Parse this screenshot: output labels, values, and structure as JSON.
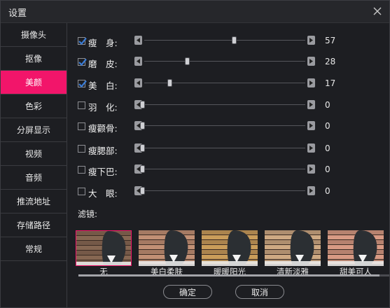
{
  "window": {
    "title": "设置"
  },
  "sidebar": {
    "items": [
      {
        "label": "摄像头",
        "active": false
      },
      {
        "label": "抠像",
        "active": false
      },
      {
        "label": "美颜",
        "active": true
      },
      {
        "label": "色彩",
        "active": false
      },
      {
        "label": "分屏显示",
        "active": false
      },
      {
        "label": "视频",
        "active": false
      },
      {
        "label": "音频",
        "active": false
      },
      {
        "label": "推流地址",
        "active": false
      },
      {
        "label": "存储路径",
        "active": false
      },
      {
        "label": "常规",
        "active": false
      }
    ]
  },
  "beauty": {
    "sliders": [
      {
        "label": "瘦　身:",
        "checked": true,
        "value": "57",
        "fraction": 0.57
      },
      {
        "label": "磨　皮:",
        "checked": true,
        "value": "28",
        "fraction": 0.28
      },
      {
        "label": "美　白:",
        "checked": true,
        "value": "17",
        "fraction": 0.17
      },
      {
        "label": "羽　化:",
        "checked": false,
        "value": "0",
        "fraction": 0
      },
      {
        "label": "瘦颧骨:",
        "checked": false,
        "value": "0",
        "fraction": 0
      },
      {
        "label": "瘦腮部:",
        "checked": false,
        "value": "0",
        "fraction": 0
      },
      {
        "label": "瘦下巴:",
        "checked": false,
        "value": "0",
        "fraction": 0
      },
      {
        "label": "大　眼:",
        "checked": false,
        "value": "0",
        "fraction": 0
      }
    ],
    "filter_title": "滤镜:",
    "filters": [
      {
        "label": "无",
        "selected": true,
        "tint": "#8a6a55"
      },
      {
        "label": "美白柔肤",
        "selected": false,
        "tint": "#c9967a"
      },
      {
        "label": "暖暖阳光",
        "selected": false,
        "tint": "#d2a35e"
      },
      {
        "label": "清新淡雅",
        "selected": false,
        "tint": "#d6b089"
      },
      {
        "label": "甜美可人",
        "selected": false,
        "tint": "#e0a08a"
      }
    ]
  },
  "buttons": {
    "ok": "确定",
    "cancel": "取消"
  },
  "colors": {
    "accent": "#f2156a",
    "background": "#1d1e22"
  }
}
